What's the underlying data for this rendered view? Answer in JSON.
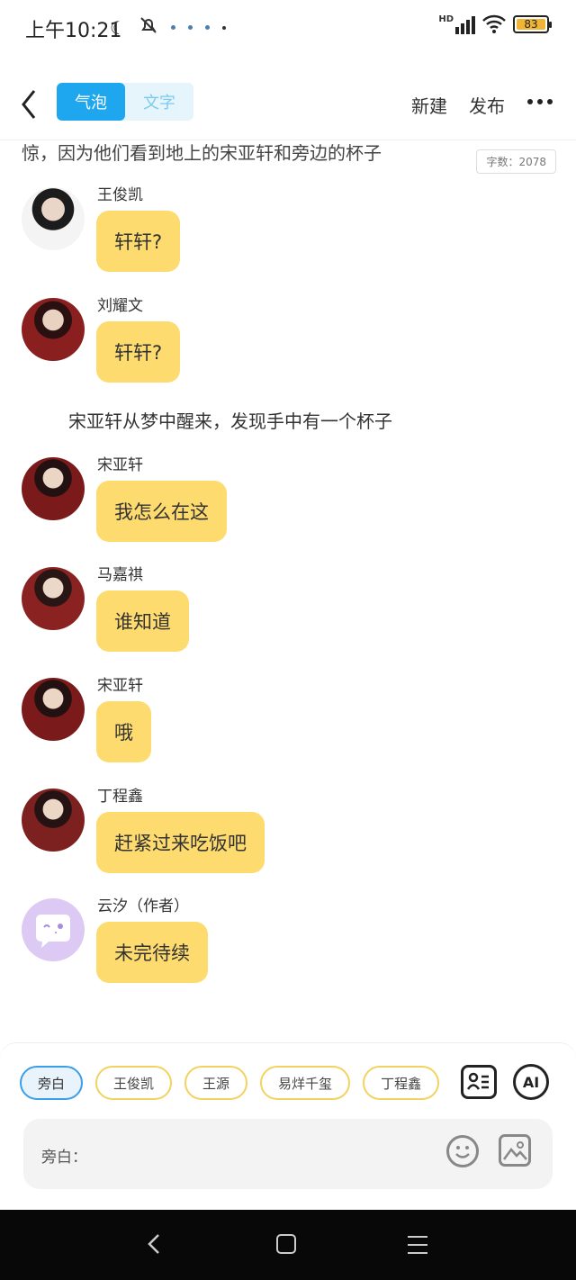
{
  "status": {
    "time": "上午10:21",
    "network": "HD",
    "battery": "83"
  },
  "header": {
    "tabs": [
      {
        "label": "气泡",
        "active": true
      },
      {
        "label": "文字",
        "active": false
      }
    ],
    "new_label": "新建",
    "publish_label": "发布"
  },
  "content": {
    "partial_text": "惊，因为他们看到地上的宋亚轩和旁边的杯子",
    "word_count": "字数：2078",
    "messages": [
      {
        "speaker": "王俊凯",
        "text": "轩轩?",
        "avatar_color": "#3a3a3a"
      },
      {
        "speaker": "刘耀文",
        "text": "轩轩?",
        "avatar_color": "#7a1e1e"
      },
      {
        "narration": "宋亚轩从梦中醒来，发现手中有一个杯子"
      },
      {
        "speaker": "宋亚轩",
        "text": "我怎么在这",
        "avatar_color": "#7a1a1a"
      },
      {
        "speaker": "马嘉祺",
        "text": "谁知道",
        "avatar_color": "#8a2222"
      },
      {
        "speaker": "宋亚轩",
        "text": "哦",
        "avatar_color": "#7a1a1a"
      },
      {
        "speaker": "丁程鑫",
        "text": "赶紧过来吃饭吧",
        "avatar_color": "#7d2020"
      },
      {
        "speaker": "云汐（作者）",
        "text": "未完待续",
        "avatar_color": "#dccaf5"
      }
    ]
  },
  "panel": {
    "chips": [
      "旁白",
      "王俊凯",
      "王源",
      "易烊千玺",
      "丁程鑫"
    ],
    "ai_label": "AI",
    "input_label": "旁白："
  },
  "colors": {
    "accent": "#1ea7ee",
    "bubble": "#fedb6e",
    "chip_border": "#f2d260"
  }
}
